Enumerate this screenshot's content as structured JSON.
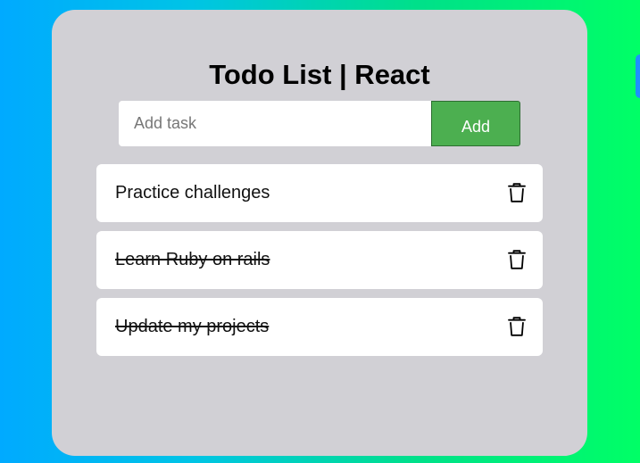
{
  "app": {
    "title": "Todo List | React"
  },
  "add_form": {
    "placeholder": "Add task",
    "value": "",
    "button_label": "Add"
  },
  "todos": [
    {
      "text": "Practice challenges",
      "completed": false
    },
    {
      "text": "Learn Ruby on rails",
      "completed": true
    },
    {
      "text": "Update my projects",
      "completed": true
    }
  ],
  "icons": {
    "delete": "trash-icon"
  },
  "colors": {
    "background_start": "#00aaff",
    "background_end": "#00ff66",
    "card": "#d1d0d5",
    "add_button": "#4caf50",
    "side_tab": "#1e90ff"
  }
}
